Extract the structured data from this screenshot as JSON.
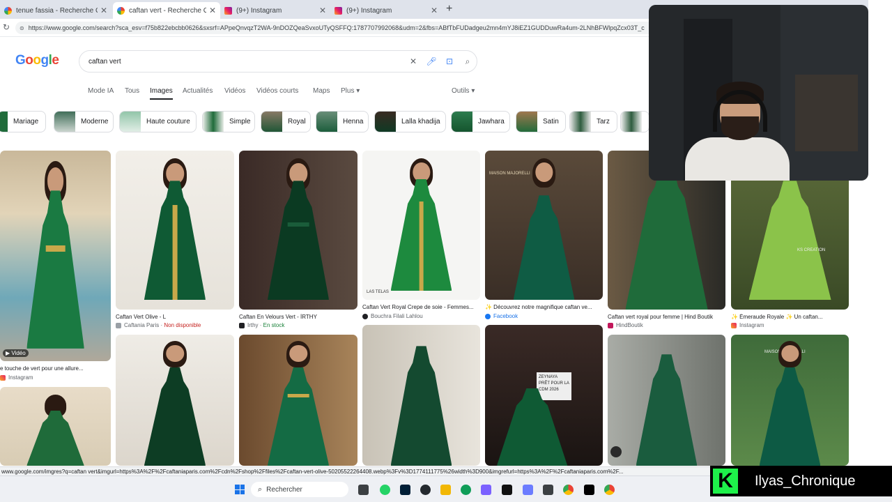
{
  "browser": {
    "tabs": [
      {
        "title": "tenue fassia - Recherche Google",
        "icon": "google-icon"
      },
      {
        "title": "caftan vert - Recherche Google",
        "icon": "google-icon"
      },
      {
        "title": "(9+) Instagram",
        "icon": "instagram-icon"
      },
      {
        "title": "(9+) Instagram",
        "icon": "instagram-icon"
      }
    ],
    "new_tab": "+",
    "url": "https://www.google.com/search?sca_esv=f75b822ebcbb0626&sxsrf=APpeQnvqzT2WA-9nDOZQeaSvxoUTyQSFFQ:1787707992068&udm=2&fbs=ABfTbFUDadgeu2mn4mYJ8iEZ1GUDDuwRa4um-2LNhBFWlpqZcx03T_c"
  },
  "google": {
    "query": "caftan vert",
    "nav": [
      "Mode IA",
      "Tous",
      "Images",
      "Actualités",
      "Vidéos",
      "Vidéos courts",
      "Maps",
      "Plus ▾",
      "Outils ▾"
    ],
    "chips": [
      "Mariage",
      "Moderne",
      "Haute couture",
      "Simple",
      "Royal",
      "Henna",
      "Lalla khadija",
      "Jawhara",
      "Satin",
      "Tarz"
    ]
  },
  "results": [
    {
      "title": "e touche de vert pour une allure...",
      "source": "Instagram",
      "badge": "▶ Vidéo"
    },
    {
      "title": "Caftan Vert Olive - L",
      "source": "Caftania Paris",
      "status": "Non disponible"
    },
    {
      "title": "Caftan En Velours Vert - İRTHY",
      "source": "Irthy",
      "status": "En stock"
    },
    {
      "title": "Caftan Vert Royal Crepe de soie - Femmes...",
      "source": "Bouchra Filali Lahlou"
    },
    {
      "title": "✨ Découvrez notre magnifique caftan ve...",
      "source": "Facebook"
    },
    {
      "title": "Caftan vert royal pour femme | Hind Boutik",
      "source": "HindBoutik"
    },
    {
      "title": "✨ Émeraude Royale ✨ Un caftan...",
      "source": "Instagram"
    }
  ],
  "image_overlays": [
    "MAISON MAJORELLI",
    "LAS TELAS",
    "KS CREATION",
    "ZEYNAYA",
    "PRÊT POUR LA CDM 2026"
  ],
  "status_url": "www.google.com/imgres?q=caftan vert&imgurl=https%3A%2F%2Fcaftaniaparis.com%2Fcdn%2Fshop%2Ffiles%2Fcaftan-vert-olive-50205522264408.webp%3Fv%3D1774111775%26width%3D900&imgrefurl=https%3A%2F%2Fcaftaniaparis.com%2F...",
  "taskbar": {
    "search_label": "Rechercher"
  },
  "stream": {
    "name": "Ilyas_Chronique",
    "logo": "K"
  },
  "colors": {
    "accent": "#1a73e8",
    "dress_green": "#1f6b3a",
    "dark_green": "#0d3d24",
    "olive_green": "#7cb342",
    "stream_green": "#1ef14a"
  }
}
